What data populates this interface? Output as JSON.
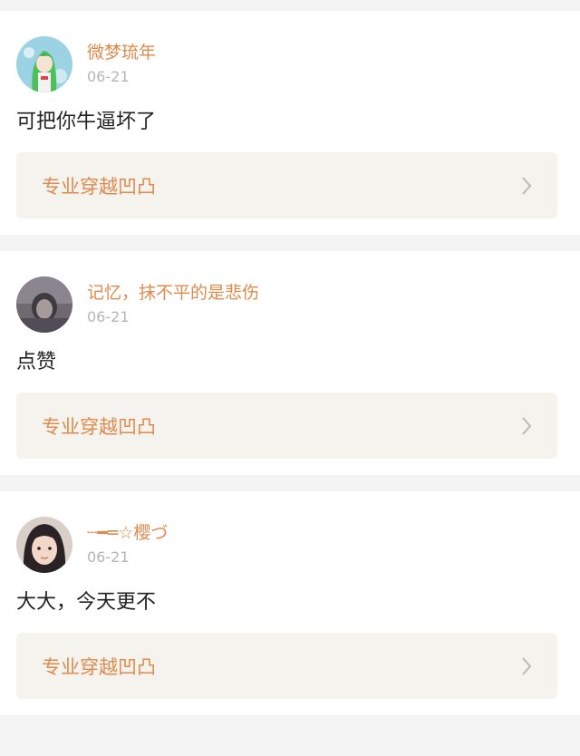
{
  "comments": [
    {
      "username": "微梦琉年",
      "date": "06-21",
      "text": "可把你牛逼坏了",
      "topic": "专业穿越凹凸",
      "avatar_icon": "green-haired-anime-avatar"
    },
    {
      "username": "记忆，抹不平的是悲伤",
      "date": "06-21",
      "text": "点赞",
      "topic": "专业穿越凹凸",
      "avatar_icon": "dark-portrait-avatar"
    },
    {
      "username": "┄━═☆樱づ",
      "date": "06-21",
      "text": "大大，今天更不",
      "topic": "专业穿越凹凸",
      "avatar_icon": "girl-portrait-avatar"
    }
  ],
  "colors": {
    "accent": "#e08a4e",
    "date": "#b5b5b5",
    "topic_bg": "#f4f3ee",
    "page_bg": "#f4f4f4"
  }
}
